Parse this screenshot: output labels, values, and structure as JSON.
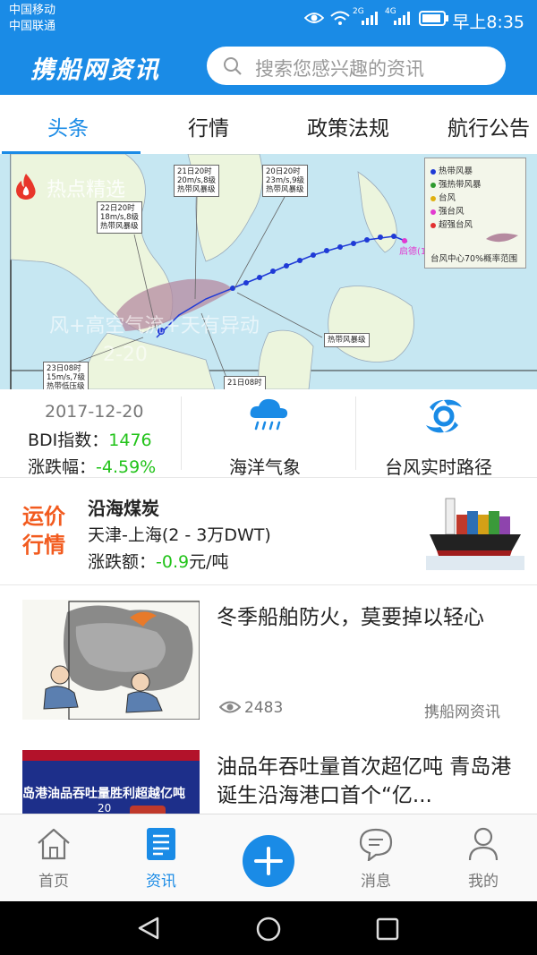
{
  "status_bar": {
    "carrier1": "中国移动",
    "carrier2": "中国联通",
    "network1": "2G",
    "network2": "4G",
    "time": "早上8:35"
  },
  "header": {
    "logo": "携船网资讯",
    "search_placeholder": "搜索您感兴趣的资讯"
  },
  "tabs": [
    {
      "label": "头条",
      "active": true
    },
    {
      "label": "行情",
      "active": false
    },
    {
      "label": "政策法规",
      "active": false
    },
    {
      "label": "航行公告",
      "active": false
    }
  ],
  "banner": {
    "section_label": "热点精选",
    "caption_line1": "风+高空气流+天有异动",
    "caption_line2": "2-20",
    "legend": {
      "items": [
        "热带风暴",
        "强热带风暴",
        "台风",
        "强台风",
        "超强台风"
      ],
      "item_colors": [
        "#1f3ad6",
        "#2e9a2e",
        "#e0b010",
        "#e23ad0",
        "#e23030"
      ],
      "footer": "台风中心70%概率范围"
    },
    "map_labels": [
      "22日20时\n18m/s,8级\n热带风暴级",
      "21日20时\n20m/s,8级\n热带风暴级",
      "20日20时\n23m/s,9级\n热带风暴级",
      "23日08时\n15m/s,7级\n热带低压级",
      "21日08时",
      "热带风暴级"
    ],
    "typhoon_name": "启德(1"
  },
  "bdi": {
    "date": "2017-12-20",
    "index_label": "BDI指数：",
    "index_value": "1476",
    "change_label": "涨跌幅：",
    "change_value": "-4.59%"
  },
  "quick_links": {
    "weather_label": "海洋气象",
    "typhoon_label": "台风实时路径"
  },
  "freight": {
    "badge_line1": "运价",
    "badge_line2": "行情",
    "title": "沿海煤炭",
    "route": "天津-上海(2 - 3万DWT)",
    "change_label": "涨跌额：",
    "change_value": "-0.9",
    "change_unit": "元/吨"
  },
  "news": [
    {
      "title": "冬季船舶防火，莫要掉以轻心",
      "views": "2483",
      "source": "携船网资讯"
    },
    {
      "title": "油品年吞吐量首次超亿吨 青岛港诞生沿海港口首个“亿...",
      "image_text": "岛港油品吞吐量胜利超越亿吨",
      "image_subtext": "20"
    }
  ],
  "bottom_nav": [
    {
      "label": "首页",
      "icon": "home-icon",
      "active": false
    },
    {
      "label": "资讯",
      "icon": "news-icon",
      "active": true
    },
    {
      "label": "",
      "icon": "plus-icon",
      "active": false
    },
    {
      "label": "消息",
      "icon": "message-icon",
      "active": false
    },
    {
      "label": "我的",
      "icon": "user-icon",
      "active": false
    }
  ],
  "colors": {
    "brand": "#1a8be6",
    "positive": "#22c31a",
    "freight_badge": "#f25b1f"
  }
}
